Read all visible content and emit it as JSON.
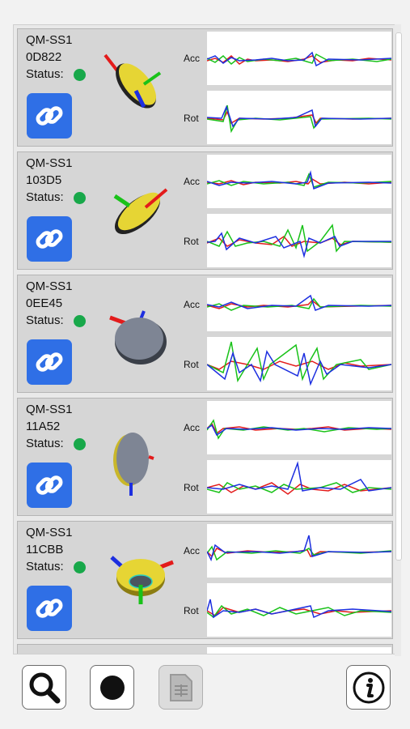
{
  "sensors": [
    {
      "name_line1": "QM-SS1",
      "name_line2": "0D822",
      "status_label": "Status:",
      "acc_label": "Acc",
      "rot_label": "Rot"
    },
    {
      "name_line1": "QM-SS1",
      "name_line2": "103D5",
      "status_label": "Status:",
      "acc_label": "Acc",
      "rot_label": "Rot"
    },
    {
      "name_line1": "QM-SS1",
      "name_line2": "0EE45",
      "status_label": "Status:",
      "acc_label": "Acc",
      "rot_label": "Rot"
    },
    {
      "name_line1": "QM-SS1",
      "name_line2": "11A52",
      "status_label": "Status:",
      "acc_label": "Acc",
      "rot_label": "Rot"
    },
    {
      "name_line1": "QM-SS1",
      "name_line2": "11CBB",
      "status_label": "Status:",
      "acc_label": "Acc",
      "rot_label": "Rot"
    }
  ],
  "colors": {
    "status_ok": "#18a84a",
    "link_button": "#2f6fe6",
    "trace_x": "#e31b1b",
    "trace_y": "#19c219",
    "trace_z": "#1d2fe0"
  },
  "toolbar": {
    "icons": [
      "search-icon",
      "record-icon",
      "document-icon",
      "info-icon"
    ]
  }
}
